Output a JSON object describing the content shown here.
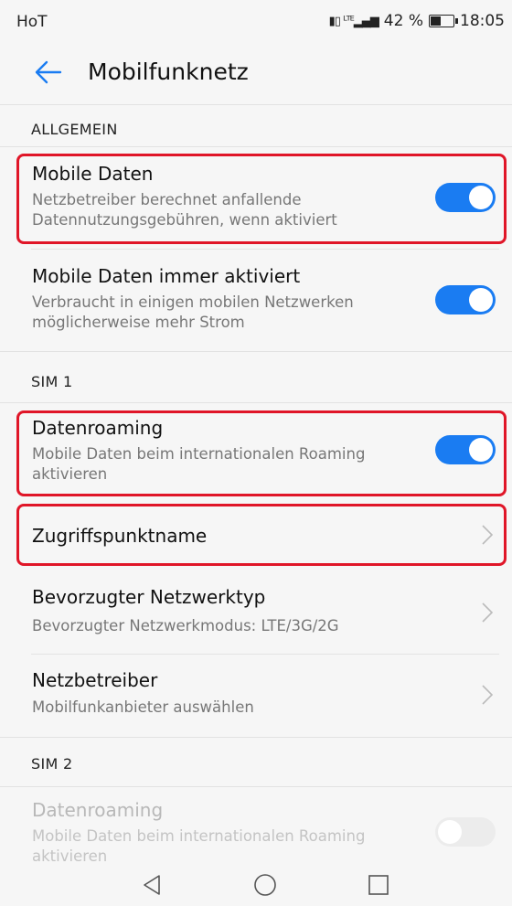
{
  "status_bar": {
    "carrier": "HoT",
    "battery": "42 %",
    "time": "18:05"
  },
  "header": {
    "title": "Mobilfunknetz"
  },
  "sections": {
    "allgemein": "ALLGEMEIN",
    "sim1": "SIM 1",
    "sim2": "SIM 2"
  },
  "items": {
    "mobile_daten": {
      "title": "Mobile Daten",
      "subtitle": "Netzbetreiber berechnet anfallende Datennutzungsgebühren, wenn aktiviert",
      "enabled": true
    },
    "mobile_daten_immer": {
      "title": "Mobile Daten immer aktiviert",
      "subtitle": "Verbraucht in einigen mobilen Netzwerken möglicherweise mehr Strom",
      "enabled": true
    },
    "datenroaming_sim1": {
      "title": "Datenroaming",
      "subtitle": "Mobile Daten beim internationalen Roaming aktivieren",
      "enabled": true
    },
    "zugriffspunktname": {
      "title": "Zugriffspunktname"
    },
    "netzwerktyp": {
      "title": "Bevorzugter Netzwerktyp",
      "subtitle": "Bevorzugter Netzwerkmodus: LTE/3G/2G"
    },
    "netzbetreiber": {
      "title": "Netzbetreiber",
      "subtitle": "Mobilfunkanbieter auswählen"
    },
    "datenroaming_sim2": {
      "title": "Datenroaming",
      "subtitle": "Mobile Daten beim internationalen Roaming aktivieren",
      "enabled": false
    }
  },
  "colors": {
    "accent": "#1a7cf2",
    "highlight": "#e01628"
  },
  "icons": {
    "back": "arrow-left-icon",
    "nav_back": "triangle-back-icon",
    "nav_home": "circle-home-icon",
    "nav_recent": "square-recent-icon"
  }
}
